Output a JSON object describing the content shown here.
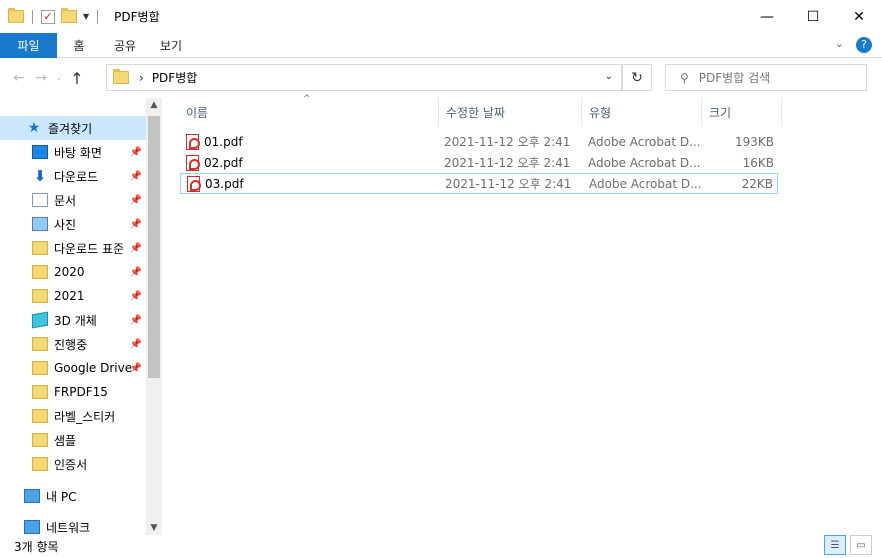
{
  "window": {
    "title": "PDF병합",
    "controls": {
      "minimize": "—",
      "maximize": "☐",
      "close": "✕"
    }
  },
  "ribbon": {
    "file_tab": "파일",
    "tabs": [
      "홈",
      "공유",
      "보기"
    ]
  },
  "address": {
    "path": "PDF병합",
    "search_placeholder": "PDF병합 검색"
  },
  "sidebar": {
    "items": [
      {
        "label": "즐겨찾기",
        "icon": "star-icon",
        "pinned": false,
        "selected": true
      },
      {
        "label": "바탕 화면",
        "icon": "desktop-icon",
        "pinned": true
      },
      {
        "label": "다운로드",
        "icon": "download-icon",
        "pinned": true
      },
      {
        "label": "문서",
        "icon": "document-icon",
        "pinned": true
      },
      {
        "label": "사진",
        "icon": "picture-icon",
        "pinned": true
      },
      {
        "label": "다운로드 표준",
        "icon": "folder-icon",
        "pinned": true
      },
      {
        "label": "2020",
        "icon": "folder-icon",
        "pinned": true
      },
      {
        "label": "2021",
        "icon": "folder-icon",
        "pinned": true
      },
      {
        "label": "3D 개체",
        "icon": "3d-objects-icon",
        "pinned": true
      },
      {
        "label": "진행중",
        "icon": "folder-icon",
        "pinned": true
      },
      {
        "label": "Google Drive",
        "icon": "folder-icon",
        "pinned": true
      },
      {
        "label": "FRPDF15",
        "icon": "folder-icon",
        "pinned": false
      },
      {
        "label": "라벨_스티커",
        "icon": "folder-icon",
        "pinned": false
      },
      {
        "label": "샘플",
        "icon": "folder-icon",
        "pinned": false
      },
      {
        "label": "인증서",
        "icon": "folder-icon",
        "pinned": false
      },
      {
        "label": "내 PC",
        "icon": "pc-icon",
        "pinned": false
      },
      {
        "label": "네트워크",
        "icon": "network-icon",
        "pinned": false
      }
    ]
  },
  "columns": {
    "name": "이름",
    "date": "수정한 날짜",
    "type": "유형",
    "size": "크기"
  },
  "files": [
    {
      "name": "01.pdf",
      "date": "2021-11-12 오후 2:41",
      "type": "Adobe Acrobat D...",
      "size": "193KB"
    },
    {
      "name": "02.pdf",
      "date": "2021-11-12 오후 2:41",
      "type": "Adobe Acrobat D...",
      "size": "16KB"
    },
    {
      "name": "03.pdf",
      "date": "2021-11-12 오후 2:41",
      "type": "Adobe Acrobat D...",
      "size": "22KB"
    }
  ],
  "status": {
    "item_count": "3개 항목"
  }
}
